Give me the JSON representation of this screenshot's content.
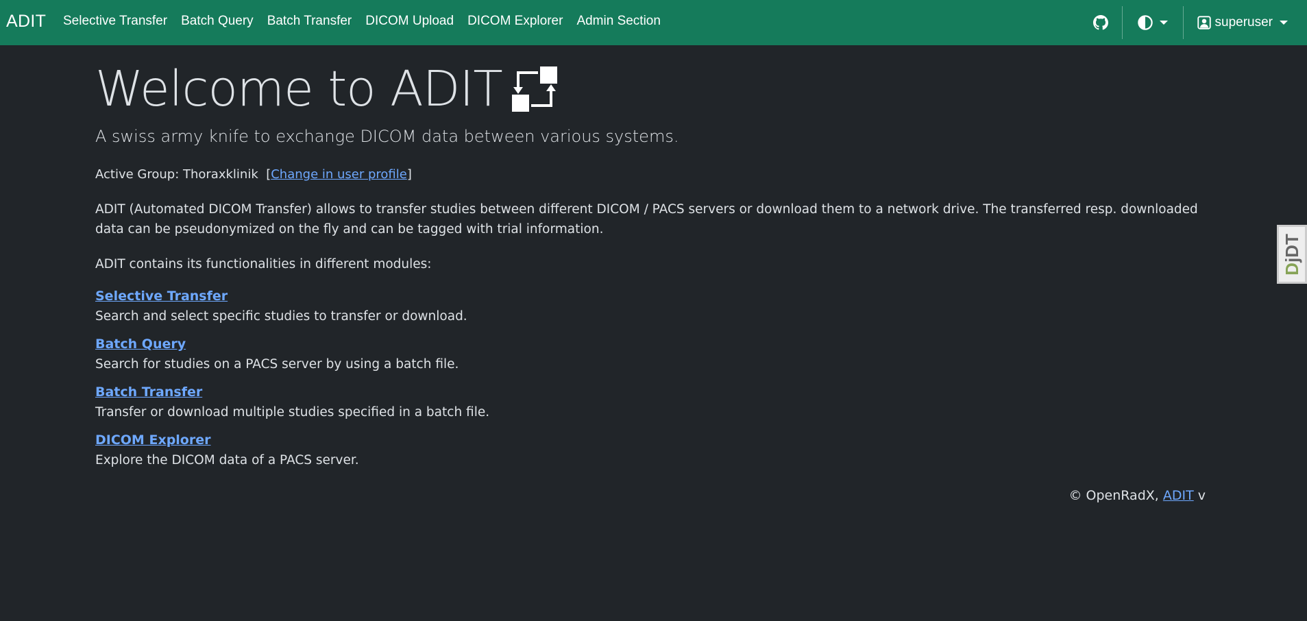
{
  "navbar": {
    "brand": "ADIT",
    "links": [
      {
        "label": "Selective Transfer"
      },
      {
        "label": "Batch Query"
      },
      {
        "label": "Batch Transfer"
      },
      {
        "label": "DICOM Upload"
      },
      {
        "label": "DICOM Explorer"
      },
      {
        "label": "Admin Section"
      }
    ],
    "user": "superuser",
    "icons": {
      "github": "github-icon",
      "theme": "contrast-icon",
      "user": "person-icon"
    }
  },
  "main": {
    "title": "Welcome to ADIT",
    "lead": "A swiss army knife to exchange DICOM data between various systems.",
    "group_prefix": "Active Group: Thoraxklinik",
    "group_link": "Change in user profile",
    "description": "ADIT (Automated DICOM Transfer) allows to transfer studies between different DICOM / PACS servers or download them to a network drive. The transferred resp. downloaded data can be pseudonymized on the fly and can be tagged with trial information.",
    "modules_intro": "ADIT contains its functionalities in different modules:",
    "modules": [
      {
        "name": "Selective Transfer",
        "desc": "Search and select specific studies to transfer or download."
      },
      {
        "name": "Batch Query",
        "desc": "Search for studies on a PACS server by using a batch file."
      },
      {
        "name": "Batch Transfer",
        "desc": "Transfer or download multiple studies specified in a batch file."
      },
      {
        "name": "DICOM Explorer",
        "desc": "Explore the DICOM data of a PACS server."
      }
    ]
  },
  "footer": {
    "prefix": "© OpenRadX, ",
    "link": "ADIT",
    "suffix": " v"
  },
  "debug_toolbar": {
    "label_a": "D",
    "label_b": "jDT"
  },
  "colors": {
    "navbar": "#157b5b",
    "background": "#212529",
    "link": "#6ea8fe"
  }
}
